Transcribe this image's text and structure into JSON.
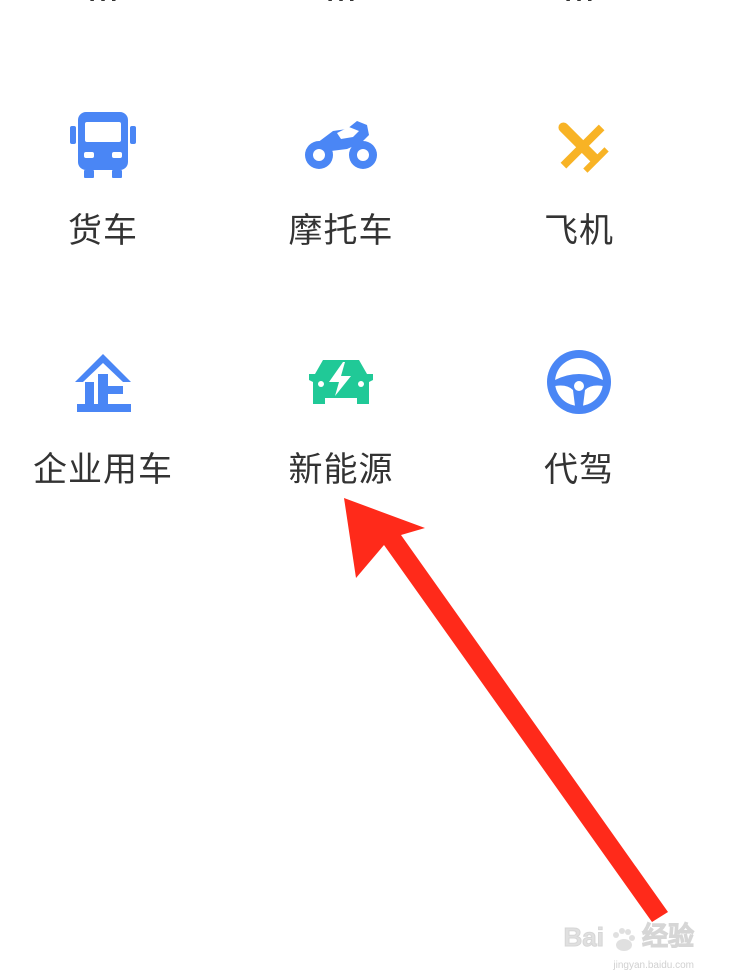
{
  "top_row": [
    {
      "label": "...",
      "partial": true
    },
    {
      "label": "...",
      "partial": true
    },
    {
      "label": "...",
      "partial": true
    }
  ],
  "grid": {
    "row1": [
      {
        "label": "货车",
        "icon": "truck-icon",
        "color": "#4a86f5"
      },
      {
        "label": "摩托车",
        "icon": "motorcycle-icon",
        "color": "#4a86f5"
      },
      {
        "label": "飞机",
        "icon": "airplane-icon",
        "color": "#f8b325"
      }
    ],
    "row2": [
      {
        "label": "企业用车",
        "icon": "enterprise-icon",
        "color": "#4a86f5"
      },
      {
        "label": "新能源",
        "icon": "ev-car-icon",
        "color": "#20c997"
      },
      {
        "label": "代驾",
        "icon": "steering-wheel-icon",
        "color": "#4a86f5"
      }
    ]
  },
  "annotation": {
    "arrow_color": "#ff2a1a"
  },
  "watermark": {
    "logo_text": "Bai",
    "logo_text2": "经验",
    "sub_text": "jingyan.baidu.com"
  }
}
